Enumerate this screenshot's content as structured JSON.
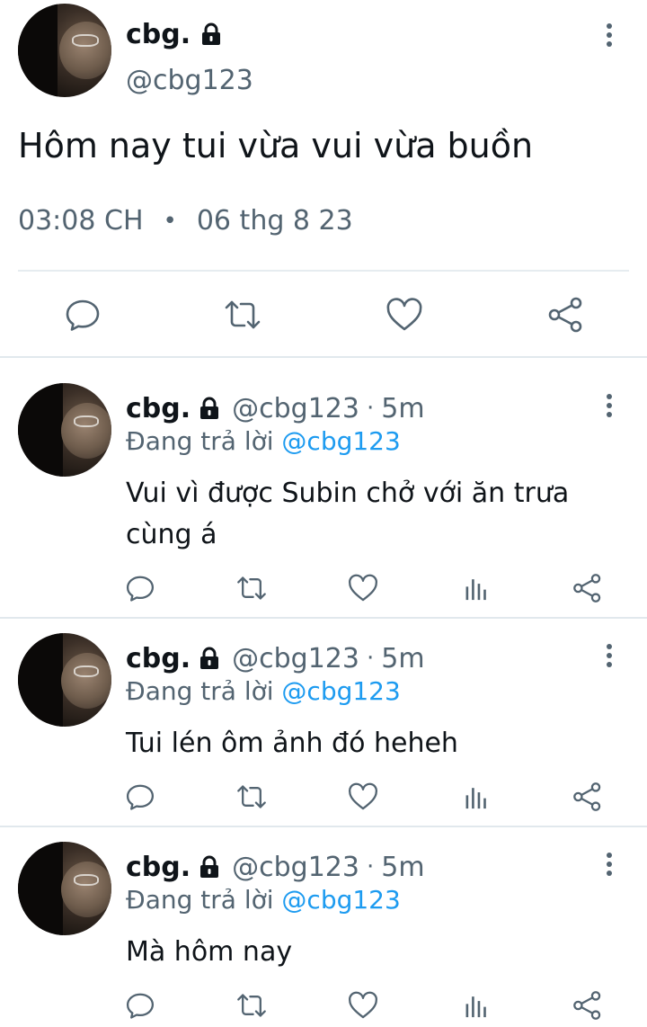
{
  "main_tweet": {
    "name": "cbg.",
    "handle": "@cbg123",
    "text": "Hôm nay tui vừa vui vừa buồn",
    "time": "03:08 CH",
    "date": "06 thg 8 23"
  },
  "replies": [
    {
      "name": "cbg.",
      "handle": "@cbg123",
      "separator": "·",
      "time": "5m",
      "replying_prefix": "Đang trả lời",
      "replying_to": "@cbg123",
      "text": "Vui vì được Subin chở với ăn trưa cùng á"
    },
    {
      "name": "cbg.",
      "handle": "@cbg123",
      "separator": "·",
      "time": "5m",
      "replying_prefix": "Đang trả lời",
      "replying_to": "@cbg123",
      "text": "Tui lén ôm ảnh đó heheh"
    },
    {
      "name": "cbg.",
      "handle": "@cbg123",
      "separator": "·",
      "time": "5m",
      "replying_prefix": "Đang trả lời",
      "replying_to": "@cbg123",
      "text": "Mà hôm nay"
    }
  ],
  "icons": {
    "reply": "comment-icon",
    "retweet": "retweet-icon",
    "like": "heart-icon",
    "views": "analytics-icon",
    "share": "share-icon",
    "more": "more-vertical-icon",
    "lock": "lock-icon"
  },
  "colors": {
    "text": "#0f1419",
    "secondary": "#536471",
    "mention": "#1d9bf0",
    "divider": "#e1e8ed"
  }
}
